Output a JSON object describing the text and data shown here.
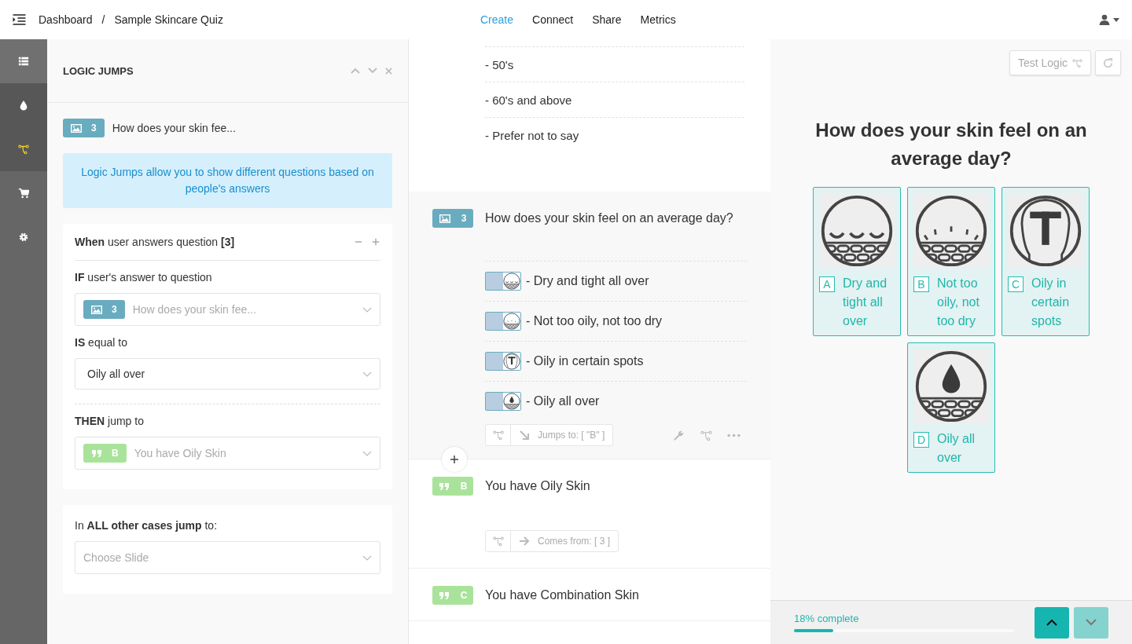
{
  "topbar": {
    "breadcrumb": [
      "Dashboard",
      "Sample Skincare Quiz"
    ],
    "separator": "/",
    "tabs": [
      {
        "label": "Create",
        "selected": true
      },
      {
        "label": "Connect",
        "selected": false
      },
      {
        "label": "Share",
        "selected": false
      },
      {
        "label": "Metrics",
        "selected": false
      }
    ]
  },
  "rail": [
    {
      "selected": false
    },
    {
      "selected": false
    },
    {
      "selected": true
    },
    {
      "selected": false
    },
    {
      "selected": false
    }
  ],
  "logic_panel": {
    "title": "LOGIC JUMPS",
    "question": {
      "kind": "picture",
      "badge": "3",
      "text": "How does your skin fee..."
    },
    "info": "Logic Jumps allow you to show different questions based on people's answers",
    "rule": {
      "when": "**When** user answers question **[3]**",
      "if_label": "**IF** user's answer to question",
      "if_select": {
        "kind": "picture",
        "badge": "3",
        "text": "How does your skin fee..."
      },
      "is_label": "**IS** equal to",
      "is_value": "Oily all over",
      "then_label": "**THEN** jump to",
      "then_select": {
        "kind": "statement",
        "badge": "B",
        "text": "You have Oily Skin"
      }
    },
    "other": {
      "label": "In **ALL other cases jump** to:",
      "placeholder": "Choose Slide"
    }
  },
  "editor": {
    "previous_answers": [
      "- 50's",
      "- 60's and above",
      "- Prefer not to say"
    ],
    "blocks": [
      {
        "kind": "picture",
        "badge": "3",
        "title": "How does your skin feel on an average day?",
        "selected": true,
        "options": [
          {
            "text": "- Dry and tight all over"
          },
          {
            "text": "- Not too oily, not too dry"
          },
          {
            "text": "- Oily in certain spots"
          },
          {
            "text": "- Oily all over"
          }
        ],
        "link": {
          "kind": "jumps",
          "text": "Jumps to: [ \"B\" ]"
        }
      },
      {
        "kind": "statement",
        "badge": "B",
        "title": "You have Oily Skin",
        "selected": false,
        "link": {
          "kind": "comes",
          "text": "Comes from: [ 3 ]"
        }
      },
      {
        "kind": "statement",
        "badge": "C",
        "title": "You have Combination Skin",
        "selected": false
      }
    ]
  },
  "preview": {
    "test_button": "Test Logic",
    "question": "How does your skin feel on an average day?",
    "choices": [
      {
        "key": "A",
        "label": "Dry and tight all over"
      },
      {
        "key": "B",
        "label": "Not too oily, not too dry"
      },
      {
        "key": "C",
        "label": "Oily in certain spots"
      },
      {
        "key": "D",
        "label": "Oily all over"
      }
    ],
    "progress": {
      "text": "18% complete",
      "level": 0.18
    },
    "nav": [
      {
        "disabled": false
      },
      {
        "disabled": true
      }
    ]
  }
}
